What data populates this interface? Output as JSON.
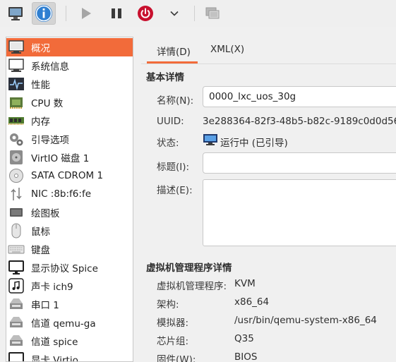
{
  "toolbar": {
    "buttons": [
      {
        "name": "console-view",
        "icon": "monitor-icon"
      },
      {
        "name": "details-view",
        "icon": "info-icon",
        "active": true
      },
      {
        "name": "run",
        "icon": "play-icon"
      },
      {
        "name": "pause",
        "icon": "pause-icon"
      },
      {
        "name": "shutdown",
        "icon": "power-icon"
      },
      {
        "name": "shutdown-menu",
        "icon": "chevron-down-icon"
      },
      {
        "name": "snapshots",
        "icon": "snapshot-icon"
      }
    ],
    "accent": "#c8102e"
  },
  "sidebar": {
    "items": [
      {
        "label": "概况",
        "icon": "overview-monitor-icon",
        "selected": true
      },
      {
        "label": "系统信息",
        "icon": "system-info-monitor-icon"
      },
      {
        "label": "性能",
        "icon": "performance-graph-icon"
      },
      {
        "label": "CPU 数",
        "icon": "cpu-chip-icon"
      },
      {
        "label": "内存",
        "icon": "memory-module-icon"
      },
      {
        "label": "引导选项",
        "icon": "boot-gears-icon"
      },
      {
        "label": "VirtIO 磁盘 1",
        "icon": "hard-disk-icon"
      },
      {
        "label": "SATA CDROM 1",
        "icon": "cdrom-disc-icon"
      },
      {
        "label": "NIC :8b:f6:fe",
        "icon": "network-arrows-icon"
      },
      {
        "label": "绘图板",
        "icon": "tablet-icon"
      },
      {
        "label": "鼠标",
        "icon": "mouse-icon"
      },
      {
        "label": "键盘",
        "icon": "keyboard-icon"
      },
      {
        "label": "显示协议 Spice",
        "icon": "display-monitor-icon"
      },
      {
        "label": "声卡 ich9",
        "icon": "sound-card-icon"
      },
      {
        "label": "串口 1",
        "icon": "serial-port-icon"
      },
      {
        "label": "信道 qemu-ga",
        "icon": "channel-qemu-ga-icon"
      },
      {
        "label": "信道 spice",
        "icon": "channel-spice-icon"
      },
      {
        "label": "显卡 Virtio",
        "icon": "video-card-icon"
      }
    ],
    "selected_color": "#f26b3a"
  },
  "tabs": [
    {
      "label": "详情(D)",
      "active": true
    },
    {
      "label": "XML(X)"
    }
  ],
  "basic": {
    "title": "基本详情",
    "name_label": "名称(N):",
    "name_value": "0000_lxc_uos_30g",
    "uuid_label": "UUID:",
    "uuid_value": "3e288364-82f3-48b5-b82c-9189c0d0d56f",
    "status_label": "状态:",
    "status_value": "运行中 (已引导)",
    "status_icon": "running-monitor-icon",
    "title_label": "标题(I):",
    "title_value": "",
    "desc_label": "描述(E):",
    "desc_value": ""
  },
  "hypervisor": {
    "title": "虚拟机管理程序详情",
    "rows": [
      {
        "label": "虚拟机管理程序:",
        "value": "KVM"
      },
      {
        "label": "架构:",
        "value": "x86_64"
      },
      {
        "label": "模拟器:",
        "value": "/usr/bin/qemu-system-x86_64"
      },
      {
        "label": "芯片组:",
        "value": "Q35"
      },
      {
        "label": "固件(W):",
        "value": "BIOS"
      }
    ]
  }
}
